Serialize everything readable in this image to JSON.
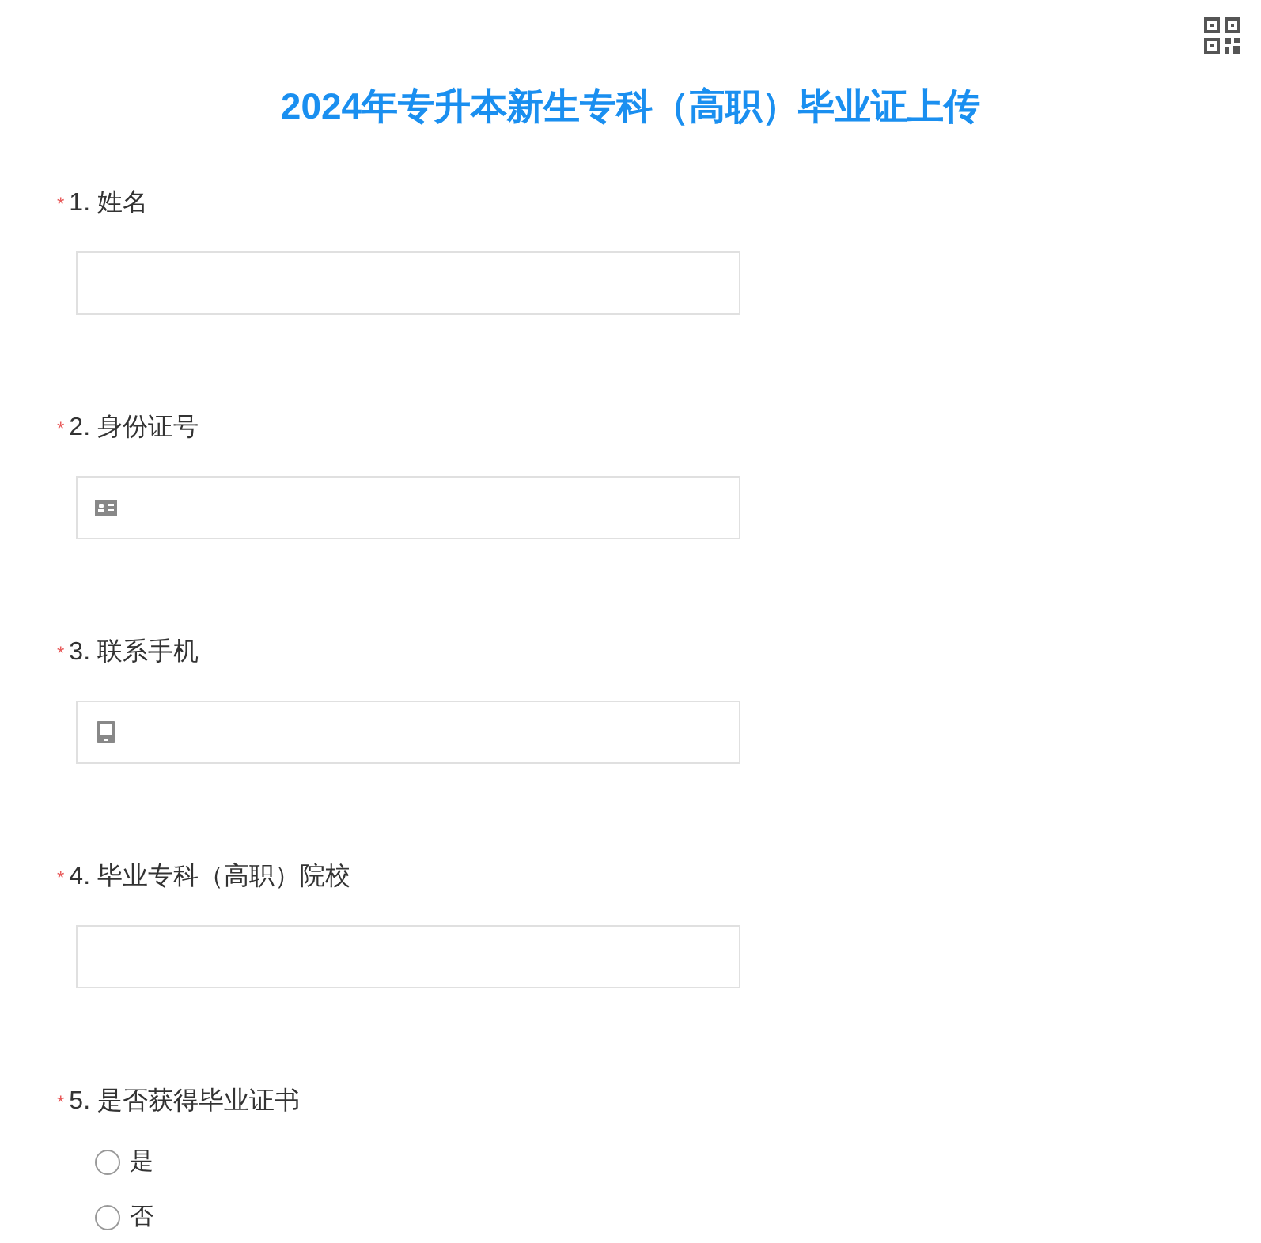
{
  "title": "2024年专升本新生专科（高职）毕业证上传",
  "questions": [
    {
      "kind": "text",
      "mark": "*",
      "label": "1. 姓名"
    },
    {
      "kind": "id_card",
      "mark": "*",
      "label": "2. 身份证号"
    },
    {
      "kind": "phone",
      "mark": "*",
      "label": "3. 联系手机"
    },
    {
      "kind": "text",
      "mark": "*",
      "label": "4. 毕业专科（高职）院校"
    },
    {
      "kind": "radio",
      "mark": "*",
      "label": "5. 是否获得毕业证书",
      "options": [
        {
          "label": "是",
          "selected": false
        },
        {
          "label": "否",
          "selected": false
        }
      ]
    }
  ]
}
